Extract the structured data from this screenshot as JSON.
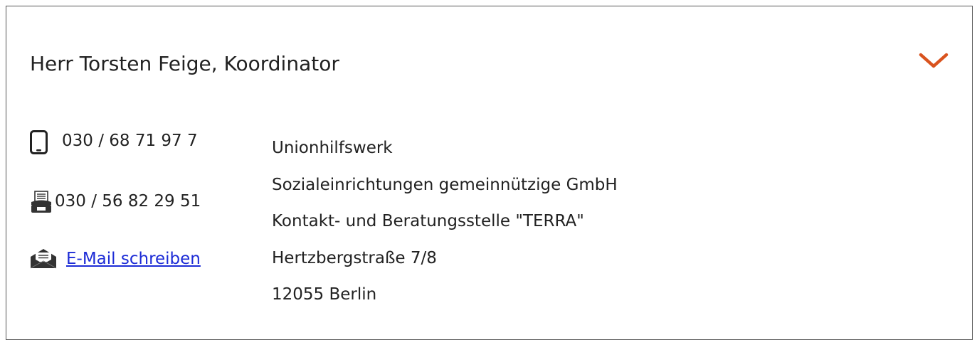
{
  "contact": {
    "title": "Herr Torsten Feige, Koordinator",
    "toggle_icon": "chevron-down-icon",
    "toggle_color": "#d9531e",
    "phone": {
      "icon": "mobile-phone-icon",
      "value": "030 / 68 71 97 7"
    },
    "fax": {
      "icon": "fax-icon",
      "value": "030 / 56 82 29 51"
    },
    "email": {
      "icon": "open-envelope-icon",
      "link_text": "E-Mail schreiben",
      "link_color": "#1c2bd6"
    },
    "address_lines": [
      "Unionhilfswerk",
      "Sozialeinrichtungen gemeinnützige GmbH",
      "Kontakt- und Beratungsstelle \"TERRA\"",
      "Hertzbergstraße 7/8",
      "12055 Berlin"
    ]
  }
}
